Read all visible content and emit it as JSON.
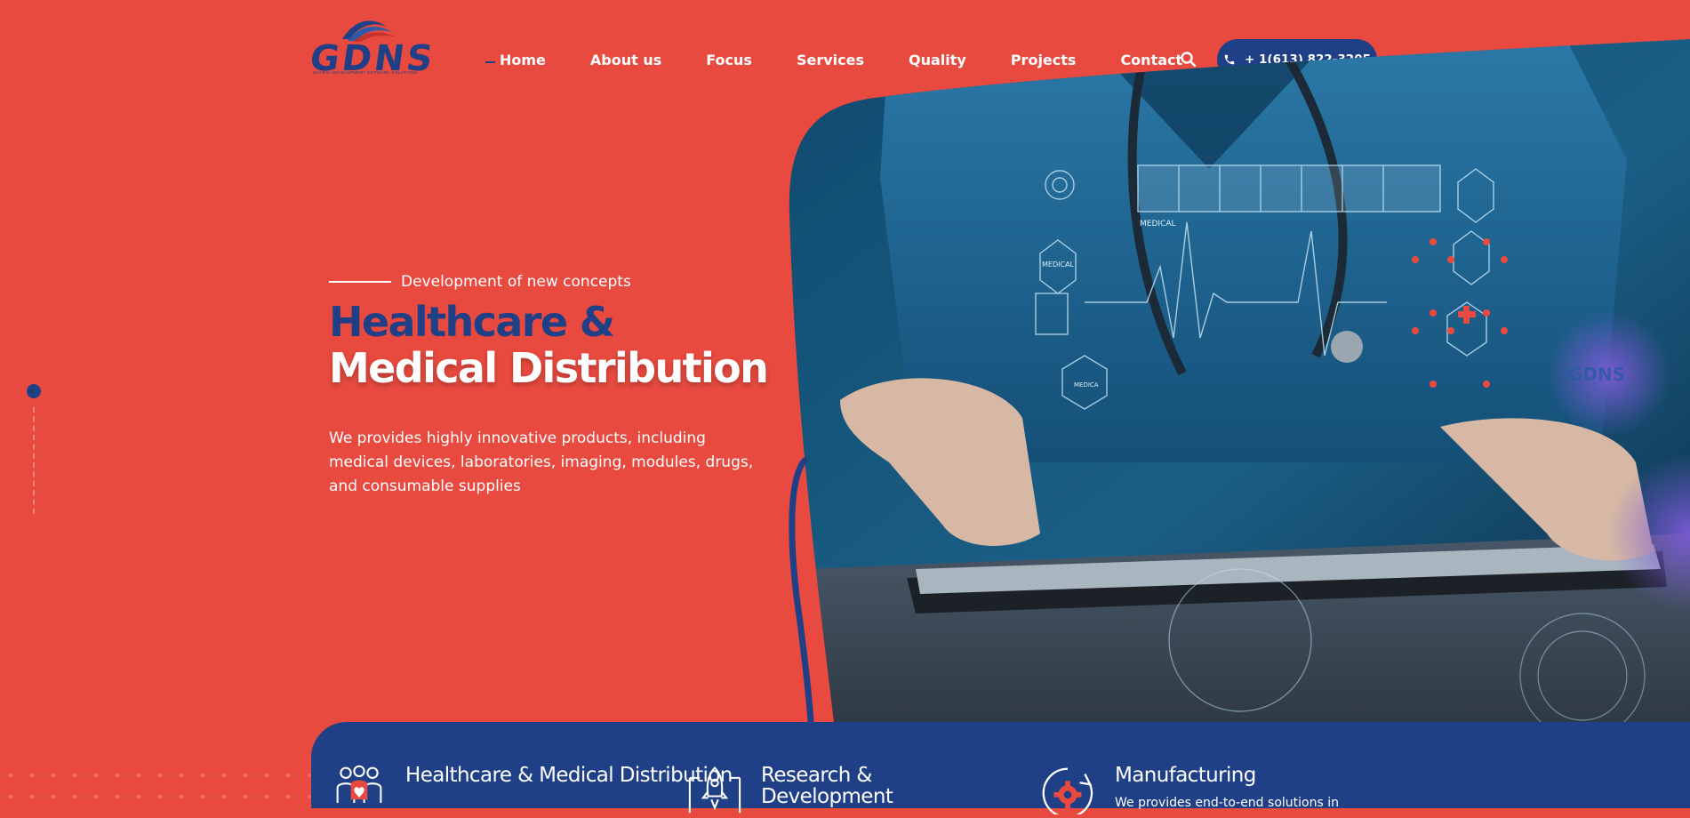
{
  "brand": {
    "logo_text": "GDNS",
    "tagline": "GLOBAL DEVELOPMENT NETWORK SOLUTIONS"
  },
  "nav": {
    "items": [
      {
        "label": "Home",
        "active": true
      },
      {
        "label": "About us"
      },
      {
        "label": "Focus"
      },
      {
        "label": "Services"
      },
      {
        "label": "Quality"
      },
      {
        "label": "Projects"
      },
      {
        "label": "Contact"
      }
    ],
    "search_icon": "search-icon",
    "phone": "+ 1(613) 822-3205"
  },
  "hero": {
    "eyebrow": "Development of new concepts",
    "title_line1": "Healthcare &",
    "title_line2": "Medical Distribution",
    "description": "We provides highly innovative products, including medical devices, laboratories, imaging, modules, drugs, and consumable supplies",
    "image_overlay": {
      "medical_1": "MEDICAL",
      "medical_2": "MEDICAL",
      "medical_3": "MEDICA",
      "watermark_logo": "GDNS"
    }
  },
  "services": [
    {
      "title": "Healthcare & Medical Distribution",
      "icon": "team-icon"
    },
    {
      "title": "Research & Development",
      "icon": "rocket-icon"
    },
    {
      "title": "Manufacturing",
      "icon": "gear-icon",
      "description": "We provides end-to-end solutions in"
    }
  ],
  "colors": {
    "primary_red": "#e84a3f",
    "navy": "#1f3f86",
    "white": "#ffffff"
  }
}
